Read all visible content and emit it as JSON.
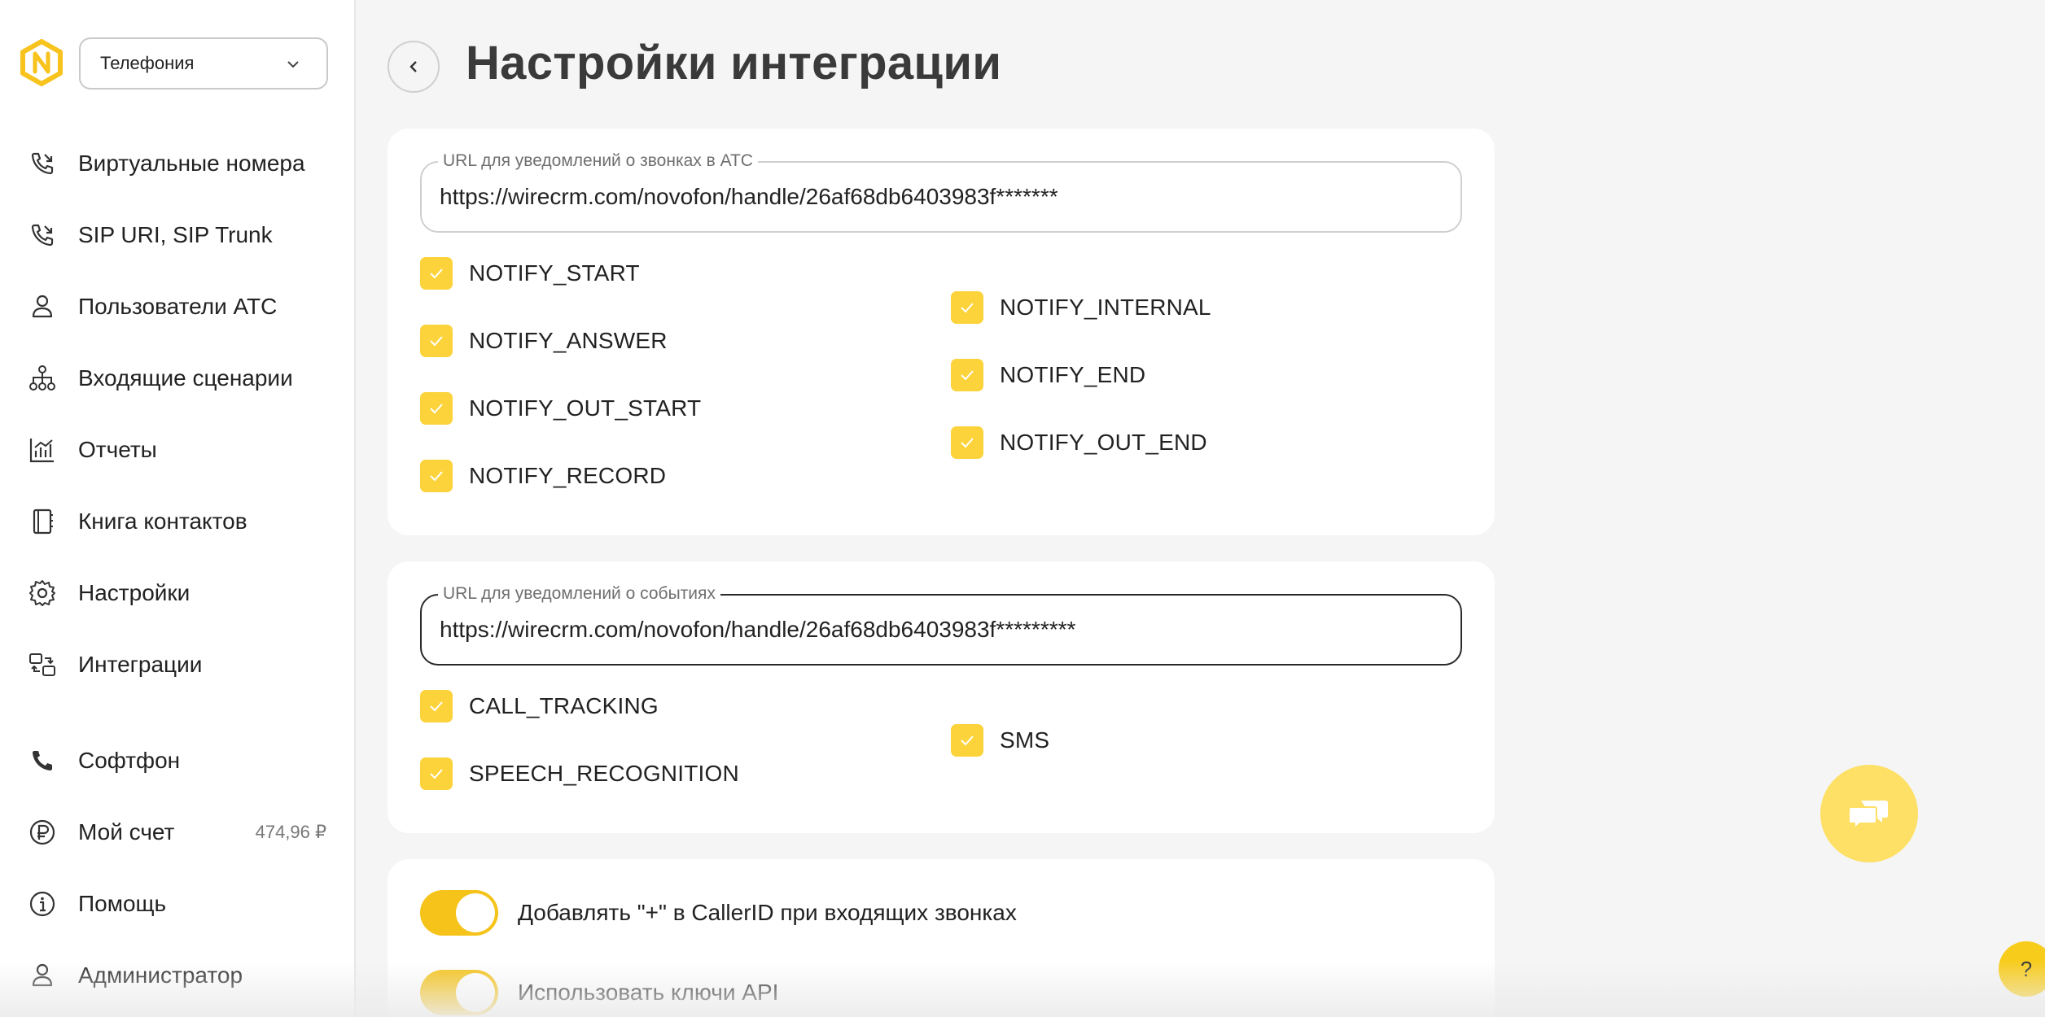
{
  "sidebar": {
    "product_select": {
      "value": "Телефония",
      "icon": "chevron-down-icon"
    },
    "items": [
      {
        "label": "Виртуальные номера",
        "icon": "phone-arrow-icon"
      },
      {
        "label": "SIP URI, SIP Trunk",
        "icon": "phone-arrow-icon"
      },
      {
        "label": "Пользователи АТС",
        "icon": "user-icon"
      },
      {
        "label": "Входящие сценарии",
        "icon": "hierarchy-icon"
      },
      {
        "label": "Отчеты",
        "icon": "chart-icon"
      },
      {
        "label": "Книга контактов",
        "icon": "book-icon"
      },
      {
        "label": "Настройки",
        "icon": "gear-icon"
      },
      {
        "label": "Интеграции",
        "icon": "sync-icon"
      },
      {
        "label": "Софтфон",
        "icon": "phone-icon"
      },
      {
        "label": "Мой счет",
        "icon": "ruble-icon",
        "balance": "474,96 ₽"
      },
      {
        "label": "Помощь",
        "icon": "info-icon"
      },
      {
        "label": "Администратор",
        "icon": "user-icon"
      }
    ]
  },
  "header": {
    "title": "Настройки интеграции",
    "back_icon": "chevron-left-icon"
  },
  "pbx_card": {
    "url_label": "URL для уведомлений о звонках в АТС",
    "url_value": "https://wirecrm.com/novofon/handle/26af68db6403983f*******",
    "checkboxes": [
      {
        "label": "NOTIFY_START",
        "checked": true
      },
      {
        "label": "NOTIFY_ANSWER",
        "checked": true
      },
      {
        "label": "NOTIFY_OUT_START",
        "checked": true
      },
      {
        "label": "NOTIFY_RECORD",
        "checked": true
      },
      {
        "label": "NOTIFY_INTERNAL",
        "checked": true
      },
      {
        "label": "NOTIFY_END",
        "checked": true
      },
      {
        "label": "NOTIFY_OUT_END",
        "checked": true
      }
    ]
  },
  "events_card": {
    "url_label": "URL для уведомлений о событиях",
    "url_value": "https://wirecrm.com/novofon/handle/26af68db6403983f*********",
    "checkboxes": [
      {
        "label": "CALL_TRACKING",
        "checked": true
      },
      {
        "label": "SPEECH_RECOGNITION",
        "checked": true
      },
      {
        "label": "SMS",
        "checked": true
      }
    ]
  },
  "options_card": {
    "toggles": [
      {
        "label": "Добавлять \"+\" в CallerID при входящих звонках",
        "on": true
      },
      {
        "label": "Использовать ключи API",
        "on": true
      }
    ]
  },
  "chat_button": {
    "icon": "chat-icon"
  },
  "help_button": {
    "label": "?"
  },
  "colors": {
    "accent": "#fcd33a",
    "toggle": "#f5c319",
    "chat": "#fde065",
    "logo": "#f7c31c"
  }
}
